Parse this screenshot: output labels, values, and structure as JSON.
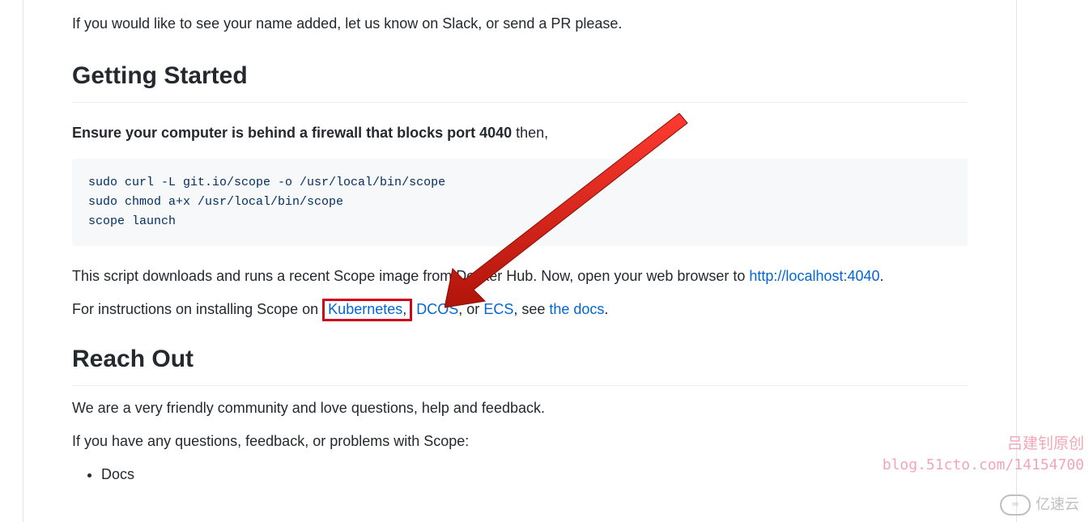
{
  "intro": "If you would like to see your name added, let us know on Slack, or send a PR please.",
  "heading_getting_started": "Getting Started",
  "ensure_bold": "Ensure your computer is behind a firewall that blocks port 4040",
  "ensure_tail": " then,",
  "code_block": "sudo curl -L git.io/scope -o /usr/local/bin/scope\nsudo chmod a+x /usr/local/bin/scope\nscope launch",
  "after_code_1": "This script downloads and runs a recent Scope image from Docker Hub. Now, open your web browser to ",
  "link_localhost": "http://localhost:4040",
  "after_code_2": ".",
  "install_line_pre": "For instructions on installing Scope on ",
  "link_kubernetes": "Kubernetes",
  "install_after_k8s": ", ",
  "link_dcos": "DCOS",
  "install_after_dcos": ", or ",
  "link_ecs": "ECS",
  "install_after_ecs": ", see ",
  "link_docs": "the docs",
  "install_tail": ".",
  "heading_reach_out": "Reach Out",
  "reach_line1": "We are a very friendly community and love questions, help and feedback.",
  "reach_line2": "If you have any questions, feedback, or problems with Scope:",
  "bullet_docs": "Docs",
  "watermark_title": "吕建钊原创",
  "watermark_url": "blog.51cto.com/14154700",
  "watermark_brand": "亿速云"
}
